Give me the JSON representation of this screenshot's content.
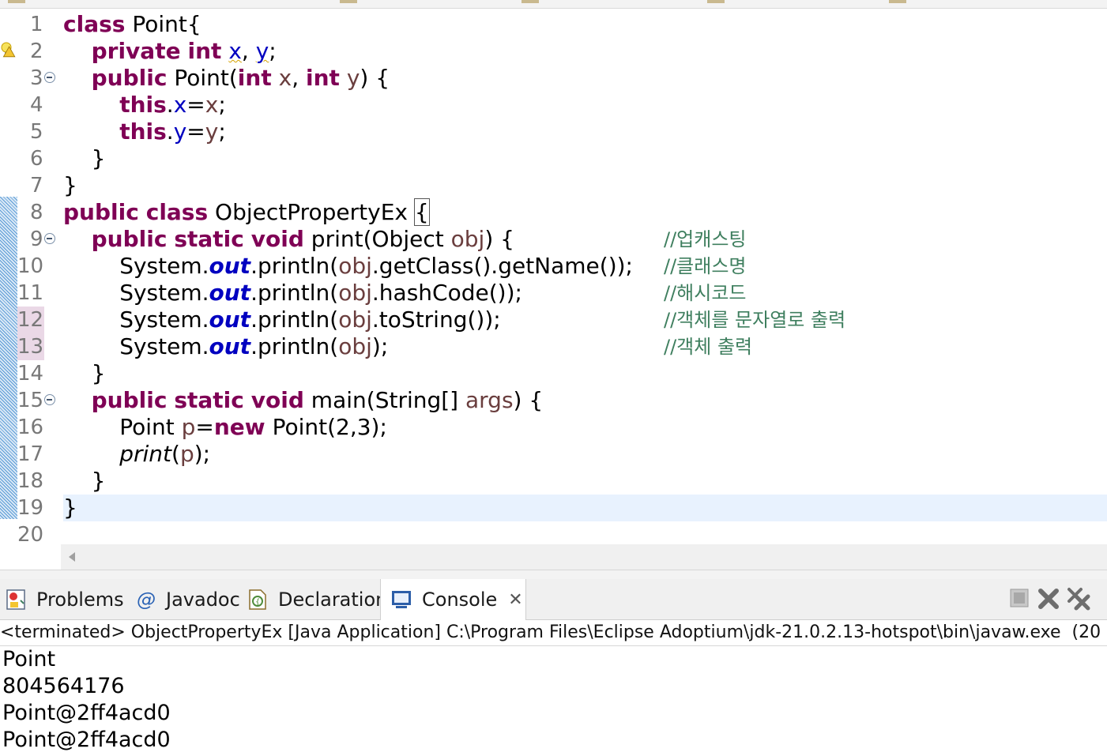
{
  "editor": {
    "line_numbers": [
      "1",
      "2",
      "3",
      "4",
      "5",
      "6",
      "7",
      "8",
      "9",
      "10",
      "11",
      "12",
      "13",
      "14",
      "15",
      "16",
      "17",
      "18",
      "19",
      "20"
    ],
    "lines": [
      [
        {
          "t": "class",
          "c": "kw"
        },
        {
          "t": " Point{"
        }
      ],
      [
        {
          "t": "    "
        },
        {
          "t": "private",
          "c": "kw"
        },
        {
          "t": " "
        },
        {
          "t": "int",
          "c": "kw"
        },
        {
          "t": " "
        },
        {
          "t": "x",
          "c": "fld warn-ul"
        },
        {
          "t": ", "
        },
        {
          "t": "y",
          "c": "fld warn-ul"
        },
        {
          "t": ";"
        }
      ],
      [
        {
          "t": "    "
        },
        {
          "t": "public",
          "c": "kw"
        },
        {
          "t": " Point("
        },
        {
          "t": "int",
          "c": "kw"
        },
        {
          "t": " "
        },
        {
          "t": "x",
          "c": "var"
        },
        {
          "t": ", "
        },
        {
          "t": "int",
          "c": "kw"
        },
        {
          "t": " "
        },
        {
          "t": "y",
          "c": "var"
        },
        {
          "t": ") {"
        }
      ],
      [
        {
          "t": "        "
        },
        {
          "t": "this",
          "c": "kw"
        },
        {
          "t": "."
        },
        {
          "t": "x",
          "c": "fld"
        },
        {
          "t": "="
        },
        {
          "t": "x",
          "c": "var"
        },
        {
          "t": ";"
        }
      ],
      [
        {
          "t": "        "
        },
        {
          "t": "this",
          "c": "kw"
        },
        {
          "t": "."
        },
        {
          "t": "y",
          "c": "fld"
        },
        {
          "t": "="
        },
        {
          "t": "y",
          "c": "var"
        },
        {
          "t": ";"
        }
      ],
      [
        {
          "t": "    }"
        }
      ],
      [
        {
          "t": "}"
        }
      ],
      [
        {
          "t": "public",
          "c": "kw"
        },
        {
          "t": " "
        },
        {
          "t": "class",
          "c": "kw"
        },
        {
          "t": " ObjectPropertyEx "
        },
        {
          "t": "{",
          "c": "box"
        }
      ],
      [
        {
          "t": "    "
        },
        {
          "t": "public",
          "c": "kw"
        },
        {
          "t": " "
        },
        {
          "t": "static",
          "c": "kw"
        },
        {
          "t": " "
        },
        {
          "t": "void",
          "c": "kw"
        },
        {
          "t": " print(Object "
        },
        {
          "t": "obj",
          "c": "var"
        },
        {
          "t": ") {"
        }
      ],
      [
        {
          "t": "        System."
        },
        {
          "t": "out",
          "c": "sfld"
        },
        {
          "t": ".println("
        },
        {
          "t": "obj",
          "c": "var"
        },
        {
          "t": ".getClass().getName());"
        }
      ],
      [
        {
          "t": "        System."
        },
        {
          "t": "out",
          "c": "sfld"
        },
        {
          "t": ".println("
        },
        {
          "t": "obj",
          "c": "var"
        },
        {
          "t": ".hashCode());"
        }
      ],
      [
        {
          "t": "        System."
        },
        {
          "t": "out",
          "c": "sfld"
        },
        {
          "t": ".println("
        },
        {
          "t": "obj",
          "c": "var"
        },
        {
          "t": ".toString());"
        }
      ],
      [
        {
          "t": "        System."
        },
        {
          "t": "out",
          "c": "sfld"
        },
        {
          "t": ".println("
        },
        {
          "t": "obj",
          "c": "var"
        },
        {
          "t": ");"
        }
      ],
      [
        {
          "t": "    }"
        }
      ],
      [
        {
          "t": "    "
        },
        {
          "t": "public",
          "c": "kw"
        },
        {
          "t": " "
        },
        {
          "t": "static",
          "c": "kw"
        },
        {
          "t": " "
        },
        {
          "t": "void",
          "c": "kw"
        },
        {
          "t": " main(String[] "
        },
        {
          "t": "args",
          "c": "var"
        },
        {
          "t": ") {"
        }
      ],
      [
        {
          "t": "        Point "
        },
        {
          "t": "p",
          "c": "var"
        },
        {
          "t": "="
        },
        {
          "t": "new",
          "c": "kw"
        },
        {
          "t": " Point(2,3);"
        }
      ],
      [
        {
          "t": "        "
        },
        {
          "t": "print",
          "c": "it"
        },
        {
          "t": "("
        },
        {
          "t": "p",
          "c": "var"
        },
        {
          "t": ");"
        }
      ],
      [
        {
          "t": "    }"
        }
      ],
      [
        {
          "t": "}"
        }
      ],
      []
    ],
    "comments": [
      "",
      "",
      "",
      "",
      "",
      "",
      "",
      "",
      "//업캐스팅",
      "//클래스명",
      "//해시코드",
      "//객체를 문자열로 출력",
      "//객체 출력",
      "",
      "",
      "",
      "",
      "",
      "",
      ""
    ],
    "folded_lines": [
      "3",
      "9",
      "15"
    ],
    "marked_lines": [
      "12",
      "13"
    ],
    "current_line": "19",
    "ruler_marked_lines": [
      "8",
      "19"
    ]
  },
  "panel": {
    "tabs": [
      {
        "label": "Problems",
        "icon": "problems-icon",
        "active": false
      },
      {
        "label": "Javadoc",
        "icon": "javadoc-icon",
        "active": false
      },
      {
        "label": "Declaration",
        "icon": "declaration-icon",
        "active": false
      },
      {
        "label": "Console",
        "icon": "console-icon",
        "active": true
      }
    ],
    "toolbar": [
      "terminate-icon",
      "remove-launch-icon",
      "remove-all-terminated-icon"
    ]
  },
  "console": {
    "description": "<terminated> ObjectPropertyEx [Java Application] C:\\Program Files\\Eclipse Adoptium\\jdk-21.0.2.13-hotspot\\bin\\javaw.exe  (20",
    "output": [
      "Point",
      "804564176",
      "Point@2ff4acd0",
      "Point@2ff4acd0"
    ]
  },
  "colors": {
    "keyword": "#7f0055",
    "field": "#0000c0",
    "local_variable": "#6a3e3e",
    "comment": "#3f7f5f",
    "current_line": "#e8f2fe"
  }
}
